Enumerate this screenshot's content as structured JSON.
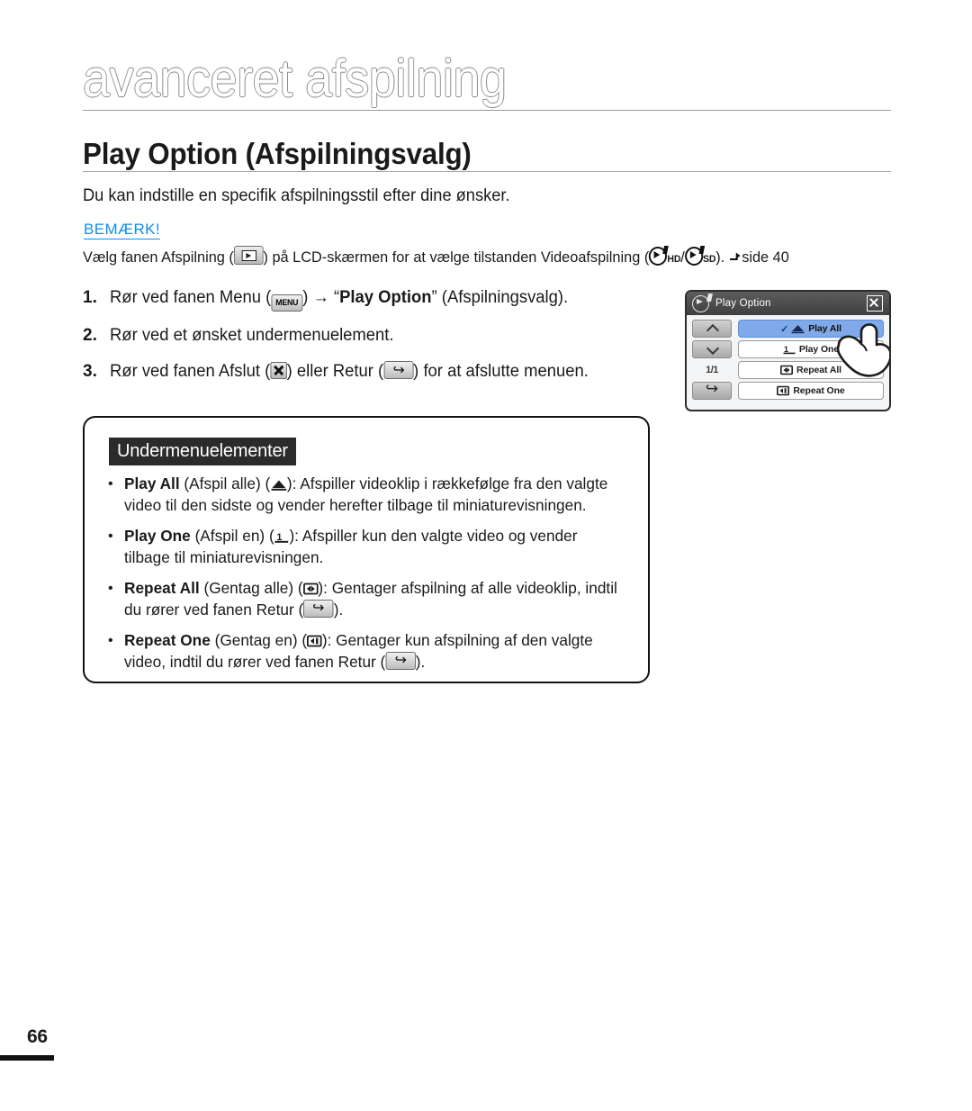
{
  "chapter": {
    "title": "avanceret afspilning"
  },
  "section": {
    "title": "Play Option (Afspilningsvalg)",
    "intro": "Du kan indstille en specifik afspilningsstil efter dine ønsker."
  },
  "note": {
    "label": "BEMÆRK!",
    "text_before_tab_icon": "Vælg fanen Afspilning (",
    "text_after_tab_icon": ") på LCD-skærmen for at vælge tilstanden Videoafspilning (",
    "hd_label": "HD",
    "separator": "/",
    "sd_label": "SD",
    "text_tail": "). ",
    "page_ref": "side 40",
    "color": "#0d8cf2"
  },
  "steps": [
    {
      "num": "1.",
      "text_1": "Rør ved fanen Menu (",
      "text_2": ") ",
      "arrow": "→",
      "quote_open": " “",
      "bold": "Play Option",
      "quote_close": "” ",
      "text_3": "(Afspilningsvalg)."
    },
    {
      "num": "2.",
      "text_1": "Rør ved et ønsket undermenuelement."
    },
    {
      "num": "3.",
      "text_1": "Rør ved fanen Afslut (",
      "text_2": ") eller Retur (",
      "text_3": ") for at afslutte menuen."
    }
  ],
  "submenu": {
    "heading": "Undermenuelementer",
    "bullet_char": "•",
    "items": [
      {
        "bold": "Play All",
        "translation": " (Afspil alle) (",
        "icon": "play-all-icon",
        "rest": "): Afspiller videoklip i rækkefølge fra den valgte video til den sidste og vender herefter tilbage til miniaturevisningen."
      },
      {
        "bold": "Play One",
        "translation": " (Afspil en) (",
        "icon": "play-one-icon",
        "rest": "): Afspiller kun den valgte video og vender tilbage til miniaturevisningen."
      },
      {
        "bold": "Repeat All",
        "translation": " (Gentag alle) (",
        "icon": "repeat-all-icon",
        "rest_1": "): Gentager afspilning af alle videoklip, indtil du rører ved fanen Retur (",
        "rest_2": ")."
      },
      {
        "bold": "Repeat One",
        "translation": " (Gentag en) (",
        "icon": "repeat-one-icon",
        "rest_1": "): Gentager kun afspilning af den valgte video, indtil du rører ved fanen Retur (",
        "rest_2": ")."
      }
    ]
  },
  "lcd": {
    "title": "Play Option",
    "page_indicator": "1/1",
    "highlight_color": "#7fa9e8",
    "titlebar_color": "#4a4a4a",
    "menu_items": [
      {
        "label": "Play All",
        "selected": true,
        "icon": "play-all-icon"
      },
      {
        "label": "Play One",
        "selected": false,
        "icon": "play-one-icon"
      },
      {
        "label": "Repeat All",
        "selected": false,
        "icon": "repeat-all-icon"
      },
      {
        "label": "Repeat One",
        "selected": false,
        "icon": "repeat-one-icon"
      }
    ],
    "check_glyph": "✓"
  },
  "footer": {
    "page_number": "66"
  }
}
